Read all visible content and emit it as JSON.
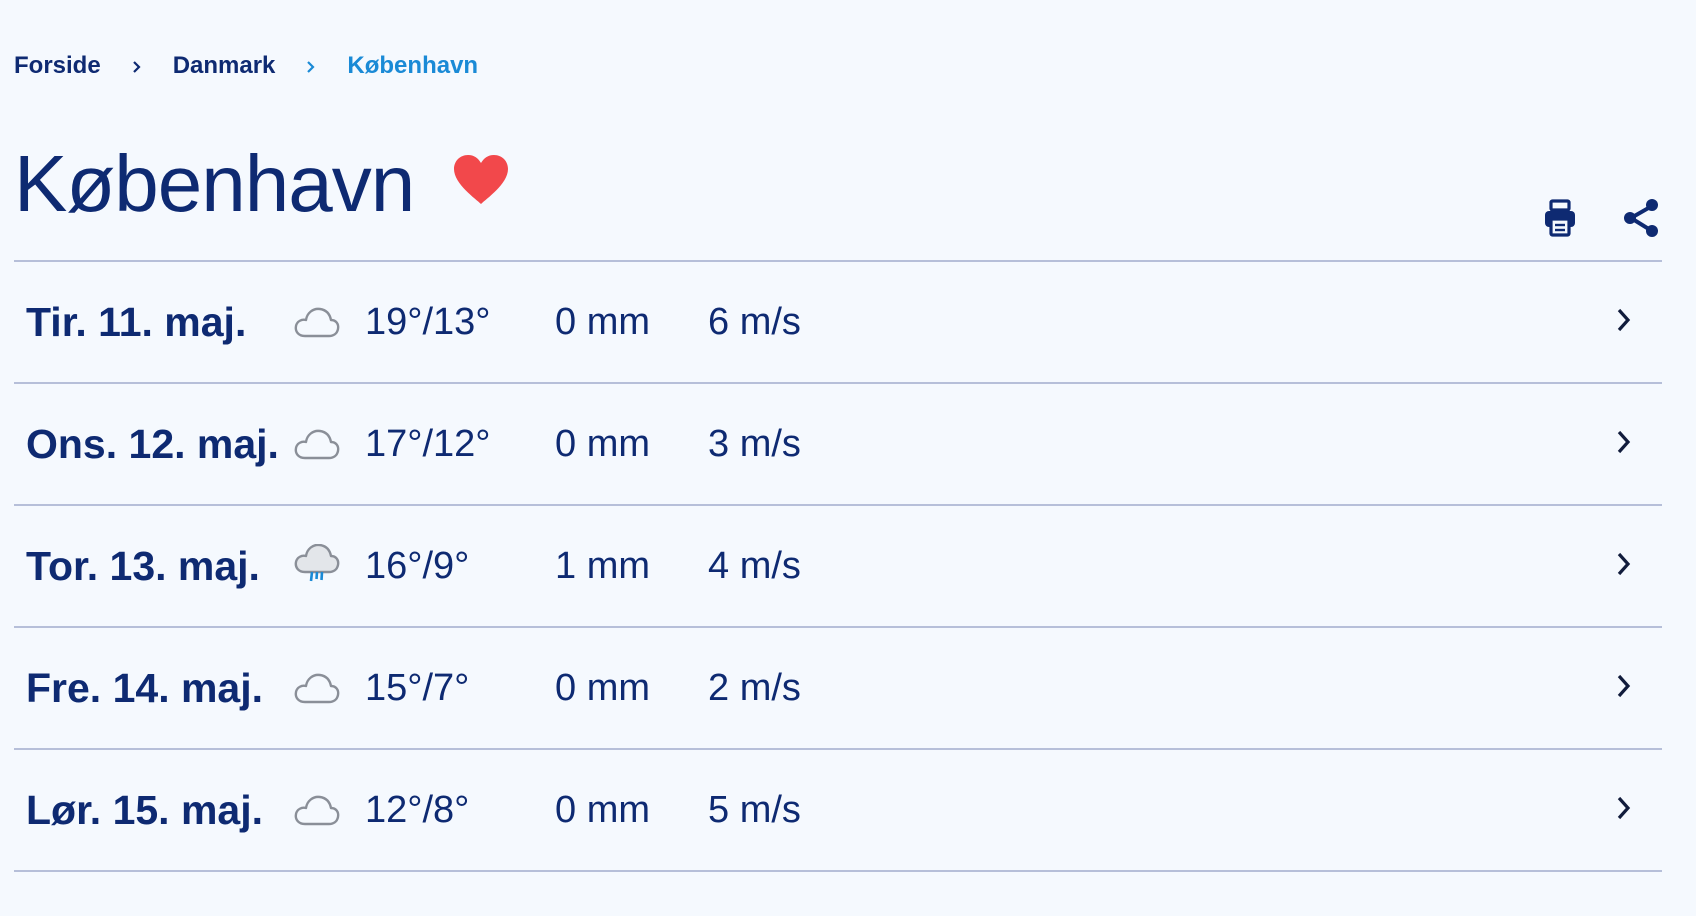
{
  "breadcrumb": {
    "items": [
      "Forside",
      "Danmark",
      "København"
    ]
  },
  "page": {
    "title": "København"
  },
  "colors": {
    "primary": "#0e2a72",
    "accent": "#1a8ad6",
    "heart": "#f2484b",
    "divider": "#b6bfd9",
    "background": "#f5f9fe"
  },
  "icons": {
    "favorite": "heart-icon",
    "print": "print-icon",
    "share": "share-icon"
  },
  "forecast": [
    {
      "day": "Tir. 11. maj.",
      "icon": "cloud-icon",
      "temp": "19°/13°",
      "precip": "0 mm",
      "wind": "6 m/s"
    },
    {
      "day": "Ons. 12. maj.",
      "icon": "cloud-icon",
      "temp": "17°/12°",
      "precip": "0 mm",
      "wind": "3 m/s"
    },
    {
      "day": "Tor. 13. maj.",
      "icon": "rain-cloud-icon",
      "temp": "16°/9°",
      "precip": "1 mm",
      "wind": "4 m/s"
    },
    {
      "day": "Fre. 14. maj.",
      "icon": "cloud-icon",
      "temp": "15°/7°",
      "precip": "0 mm",
      "wind": "2 m/s"
    },
    {
      "day": "Lør. 15. maj.",
      "icon": "cloud-icon",
      "temp": "12°/8°",
      "precip": "0 mm",
      "wind": "5 m/s"
    }
  ]
}
